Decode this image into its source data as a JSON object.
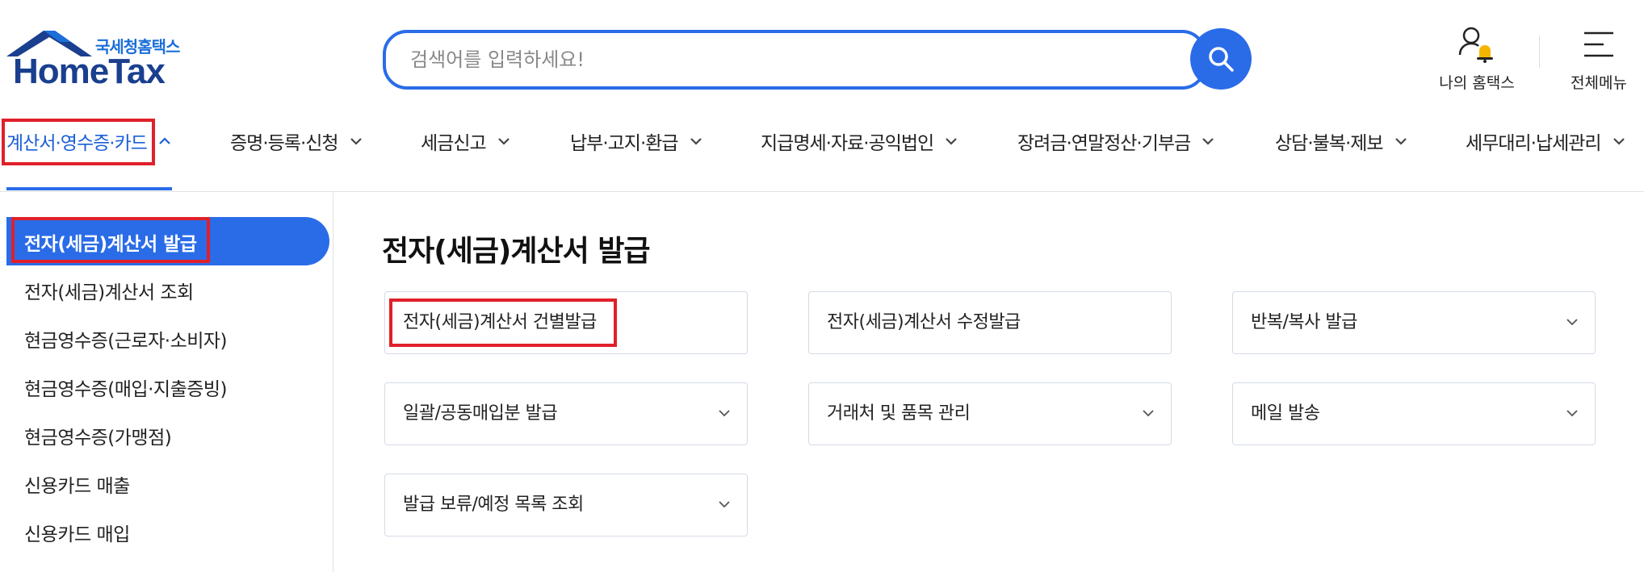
{
  "header": {
    "logo_sub": "국세청홈택스",
    "logo_main": "HomeTax",
    "search_placeholder": "검색어를 입력하세요!",
    "my_hometax": "나의 홈택스",
    "all_menu": "전체메뉴"
  },
  "gnb": [
    {
      "label": "계산서·영수증·카드",
      "active": true
    },
    {
      "label": "증명·등록·신청"
    },
    {
      "label": "세금신고"
    },
    {
      "label": "납부·고지·환급"
    },
    {
      "label": "지급명세·자료·공익법인"
    },
    {
      "label": "장려금·연말정산·기부금"
    },
    {
      "label": "상담·불복·제보"
    },
    {
      "label": "세무대리·납세관리"
    }
  ],
  "sidebar": {
    "items": [
      {
        "label": "전자(세금)계산서 발급",
        "active": true
      },
      {
        "label": "전자(세금)계산서 조회"
      },
      {
        "label": "현금영수증(근로자·소비자)"
      },
      {
        "label": "현금영수증(매입·지출증빙)"
      },
      {
        "label": "현금영수증(가맹점)"
      },
      {
        "label": "신용카드 매출"
      },
      {
        "label": "신용카드 매입"
      }
    ]
  },
  "content": {
    "title": "전자(세금)계산서 발급",
    "cards": [
      {
        "label": "전자(세금)계산서 건별발급",
        "has_chevron": false
      },
      {
        "label": "전자(세금)계산서 수정발급",
        "has_chevron": false
      },
      {
        "label": "반복/복사 발급",
        "has_chevron": true
      },
      {
        "label": "일괄/공동매입분 발급",
        "has_chevron": true
      },
      {
        "label": "거래처 및 품목 관리",
        "has_chevron": true
      },
      {
        "label": "메일 발송",
        "has_chevron": true
      },
      {
        "label": "발급 보류/예정 목록 조회",
        "has_chevron": true
      }
    ]
  },
  "colors": {
    "accent": "#2a6ce8",
    "highlight": "#e0202a",
    "logo_dark": "#1a3f8f"
  }
}
